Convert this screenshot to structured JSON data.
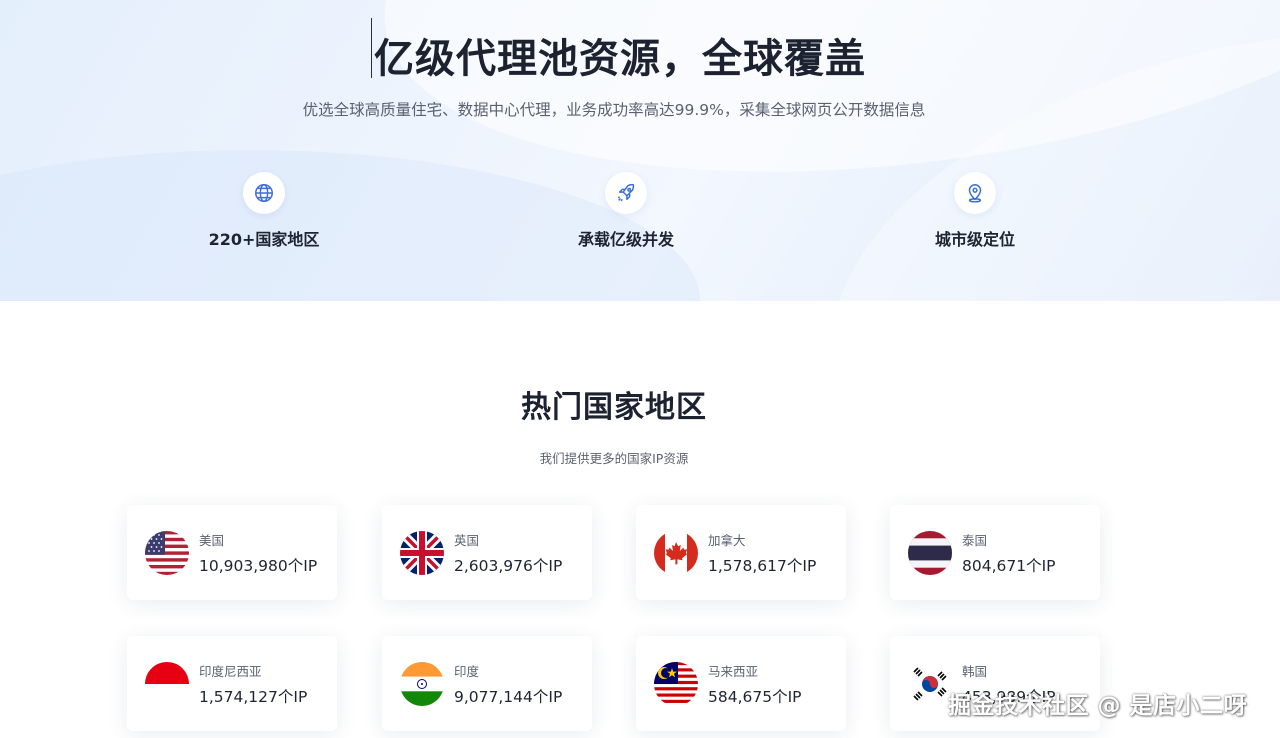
{
  "hero": {
    "title": "亿级代理池资源，全球覆盖",
    "subtitle": "优选全球高质量住宅、数据中心代理，业务成功率高达99.9%，采集全球网页公开数据信息",
    "features": [
      {
        "label": "220+国家地区",
        "icon": "globe-icon"
      },
      {
        "label": "承载亿级并发",
        "icon": "rocket-icon"
      },
      {
        "label": "城市级定位",
        "icon": "location-pin-icon"
      }
    ]
  },
  "section": {
    "title": "热门国家地区",
    "subtitle": "我们提供更多的国家IP资源"
  },
  "countries": [
    {
      "name": "美国",
      "count": "10,903,980个IP",
      "flag": "us-flag-icon"
    },
    {
      "name": "英国",
      "count": "2,603,976个IP",
      "flag": "uk-flag-icon"
    },
    {
      "name": "加拿大",
      "count": "1,578,617个IP",
      "flag": "canada-flag-icon"
    },
    {
      "name": "泰国",
      "count": "804,671个IP",
      "flag": "thailand-flag-icon"
    },
    {
      "name": "印度尼西亚",
      "count": "1,574,127个IP",
      "flag": "indonesia-flag-icon"
    },
    {
      "name": "印度",
      "count": "9,077,144个IP",
      "flag": "india-flag-icon"
    },
    {
      "name": "马来西亚",
      "count": "584,675个IP",
      "flag": "malaysia-flag-icon"
    },
    {
      "name": "韩国",
      "count": "453,989个IP",
      "flag": "korea-flag-icon"
    }
  ],
  "watermark": "掘金技术社区 @ 是店小二呀",
  "colors": {
    "accent": "#3b6fd6",
    "hero_bg": "#e8f1fd",
    "text": "#1f2433",
    "muted": "#5a6170"
  }
}
